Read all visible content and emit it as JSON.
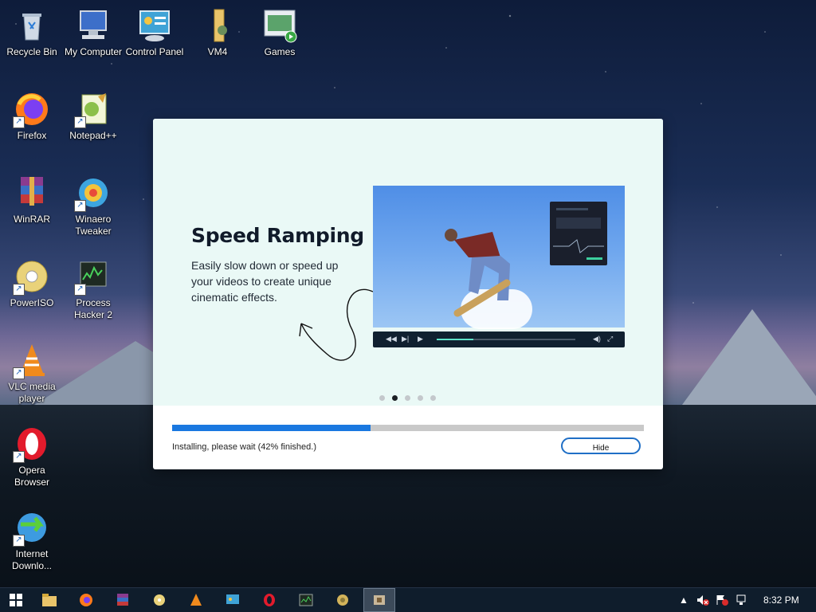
{
  "desktop": {
    "icons": [
      {
        "label": "Recycle Bin"
      },
      {
        "label": "My Computer"
      },
      {
        "label": "Control Panel"
      },
      {
        "label": "VM4"
      },
      {
        "label": "Games"
      },
      {
        "label": "Firefox"
      },
      {
        "label": "Notepad++"
      },
      {
        "label": "WinRAR"
      },
      {
        "label": "Winaero Tweaker"
      },
      {
        "label": "PowerISO"
      },
      {
        "label": "Process Hacker 2"
      },
      {
        "label": "VLC media player"
      },
      {
        "label": "Opera Browser"
      },
      {
        "label": "Internet Downlo..."
      }
    ]
  },
  "installer": {
    "title": "Speed Ramping",
    "description": "Easily slow down or speed up your videos to create unique cinematic effects.",
    "carousel": {
      "count": 5,
      "active_index": 1
    },
    "progress_fraction": 0.42,
    "status_text": "Installing, please wait (42% finished.)",
    "hide_label": "Hide"
  },
  "taskbar": {
    "apps": [
      "start-button",
      "file-explorer",
      "firefox",
      "winrar",
      "poweriso",
      "vlc",
      "control-panel",
      "opera",
      "process-hacker",
      "media-app",
      "installer-app"
    ],
    "active_app": "installer-app",
    "time": "8:32 PM"
  },
  "colors": {
    "accent": "#1a78e0",
    "dialog_bg": "#eaf9f6",
    "taskbar": "#0f1d2c"
  }
}
